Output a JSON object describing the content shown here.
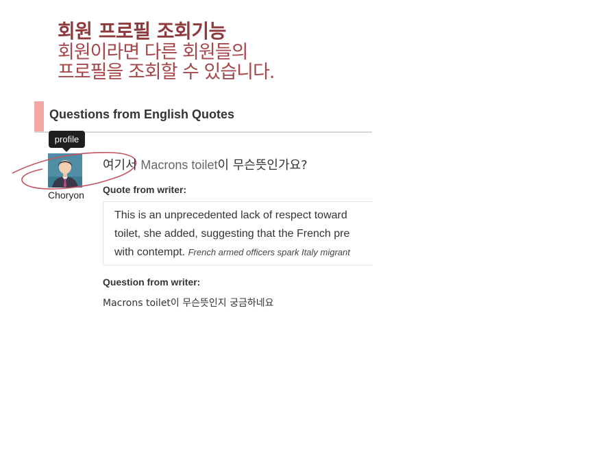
{
  "headline": {
    "title": "회원 프로필 조회기능",
    "sub_line1": "회원이라면 다른 회원들의",
    "sub_line2": "프로필을 조회할 수 있습니다."
  },
  "section": {
    "title": "Questions from English Quotes"
  },
  "profile": {
    "tooltip": "profile",
    "username": "Choryon"
  },
  "question": {
    "prefix": "여기서 ",
    "highlight": "Macrons toilet",
    "suffix": "이 무슨뜻인가요?"
  },
  "quote": {
    "label": "Quote from writer:",
    "line1": "This is an unprecedented lack of respect toward",
    "line2": "toilet, she added, suggesting that the French pre",
    "line3": "with contempt. ",
    "source": "French armed officers spark Italy migrant"
  },
  "writer_question": {
    "label": "Question from writer:",
    "text": "Macrons toilet이 무슨뜻인지 궁금하네요"
  },
  "colors": {
    "headline": "#8e3a3d",
    "accent": "#f2a7a4",
    "annotation": "#c4535f"
  }
}
